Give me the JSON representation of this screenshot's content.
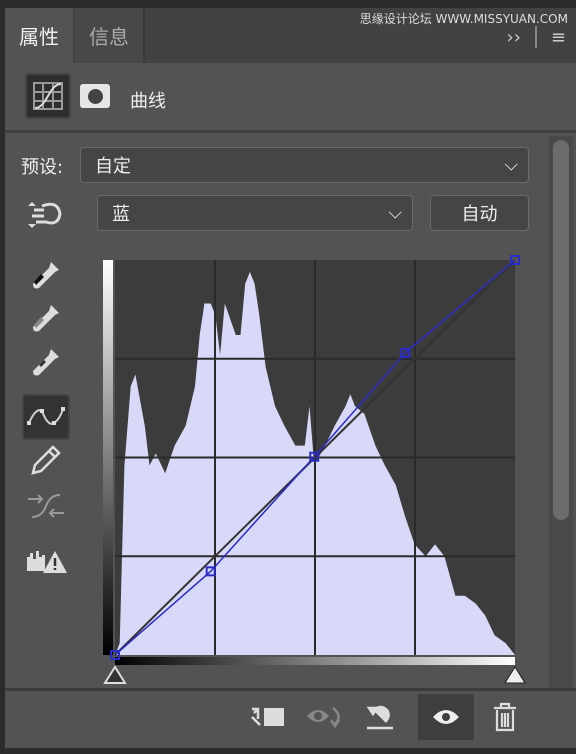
{
  "tabs": [
    {
      "label": "属性",
      "active": true
    },
    {
      "label": "信息",
      "active": false
    }
  ],
  "watermark": "思缘设计论坛 WWW.MISSYUAN.COM",
  "header": {
    "title": "曲线",
    "icons": [
      "curves-adjustment-icon",
      "mask-icon"
    ]
  },
  "preset": {
    "label": "预设:",
    "value": "自定"
  },
  "channel": {
    "value": "蓝",
    "auto_label": "自动"
  },
  "tools": [
    "on-image-adjust-icon",
    "black-eyedropper-icon",
    "gray-eyedropper-icon",
    "white-eyedropper-icon",
    "curve-points-icon",
    "pencil-icon",
    "smooth-curve-icon",
    "clipping-warning-icon"
  ],
  "curve": {
    "channel_color": "#2b2bc8",
    "points": [
      [
        0,
        0
      ],
      [
        61,
        54
      ],
      [
        127,
        128
      ],
      [
        185,
        195
      ],
      [
        255,
        255
      ]
    ],
    "histogram_color": "#d8d8f8",
    "histogram": [
      [
        0,
        0
      ],
      [
        3,
        3
      ],
      [
        6,
        48
      ],
      [
        10,
        68
      ],
      [
        13,
        71
      ],
      [
        19,
        58
      ],
      [
        22,
        48
      ],
      [
        26,
        51
      ],
      [
        32,
        46
      ],
      [
        38,
        53
      ],
      [
        45,
        58
      ],
      [
        51,
        68
      ],
      [
        54,
        81
      ],
      [
        57,
        89
      ],
      [
        61,
        89
      ],
      [
        64,
        86
      ],
      [
        67,
        76
      ],
      [
        70,
        89
      ],
      [
        77,
        81
      ],
      [
        80,
        81
      ],
      [
        83,
        94
      ],
      [
        86,
        97
      ],
      [
        89,
        94
      ],
      [
        92,
        86
      ],
      [
        96,
        73
      ],
      [
        102,
        63
      ],
      [
        108,
        58
      ],
      [
        115,
        53
      ],
      [
        121,
        53
      ],
      [
        124,
        63
      ],
      [
        127,
        48
      ],
      [
        134,
        53
      ],
      [
        140,
        58
      ],
      [
        147,
        63
      ],
      [
        150,
        66
      ],
      [
        153,
        63
      ],
      [
        159,
        61
      ],
      [
        166,
        53
      ],
      [
        172,
        48
      ],
      [
        179,
        43
      ],
      [
        185,
        35
      ],
      [
        191,
        28
      ],
      [
        198,
        25
      ],
      [
        204,
        28
      ],
      [
        210,
        25
      ],
      [
        217,
        15
      ],
      [
        223,
        15
      ],
      [
        230,
        13
      ],
      [
        236,
        10
      ],
      [
        242,
        5
      ],
      [
        249,
        3
      ],
      [
        255,
        0
      ]
    ]
  },
  "bottom_tools": [
    "clip-to-layer-icon",
    "view-previous-state-icon",
    "reset-icon",
    "toggle-visibility-icon",
    "delete-icon"
  ]
}
